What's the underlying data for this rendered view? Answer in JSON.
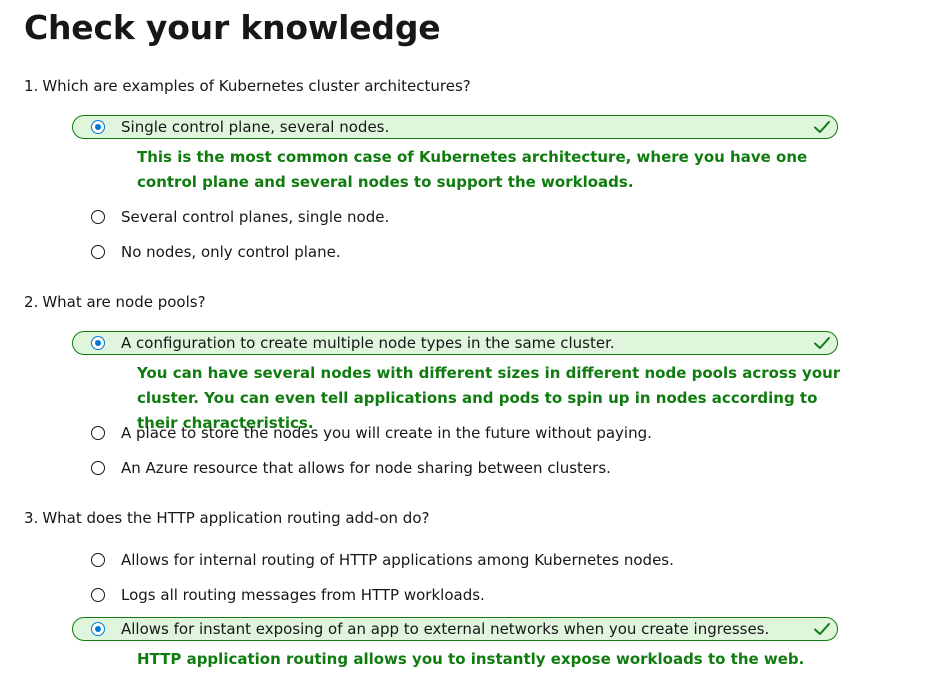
{
  "page": {
    "title": "Check your knowledge"
  },
  "questions": [
    {
      "number": "1.",
      "text": "Which are examples of Kubernetes cluster architectures?",
      "options": [
        {
          "label": "Single control plane, several nodes.",
          "selected": true,
          "correct": true
        },
        {
          "label": "Several control planes, single node.",
          "selected": false,
          "correct": false
        },
        {
          "label": "No nodes, only control plane.",
          "selected": false,
          "correct": false
        }
      ],
      "feedback": "This is the most common case of Kubernetes architecture, where you have one control plane and several nodes to support the workloads."
    },
    {
      "number": "2.",
      "text": "What are node pools?",
      "options": [
        {
          "label": "A configuration to create multiple node types in the same cluster.",
          "selected": true,
          "correct": true
        },
        {
          "label": "A place to store the nodes you will create in the future without paying.",
          "selected": false,
          "correct": false
        },
        {
          "label": "An Azure resource that allows for node sharing between clusters.",
          "selected": false,
          "correct": false
        }
      ],
      "feedback": "You can have several nodes with different sizes in different node pools across your cluster. You can even tell applications and pods to spin up in nodes according to their characteristics."
    },
    {
      "number": "3.",
      "text": "What does the HTTP application routing add-on do?",
      "options": [
        {
          "label": "Allows for internal routing of HTTP applications among Kubernetes nodes.",
          "selected": false,
          "correct": false
        },
        {
          "label": "Logs all routing messages from HTTP workloads.",
          "selected": false,
          "correct": false
        },
        {
          "label": "Allows for instant exposing of an app to external networks when you create ingresses.",
          "selected": true,
          "correct": true
        }
      ],
      "feedback": "HTTP application routing allows you to instantly expose workloads to the web."
    }
  ],
  "colors": {
    "correct_green": "#107c10",
    "correct_bg": "#dff6dd",
    "radio_selected": "#0078d4",
    "text": "#171717"
  },
  "icons": {
    "correct": "checkmark-icon",
    "selected": "radio-selected-icon",
    "unselected": "radio-unselected-icon"
  }
}
